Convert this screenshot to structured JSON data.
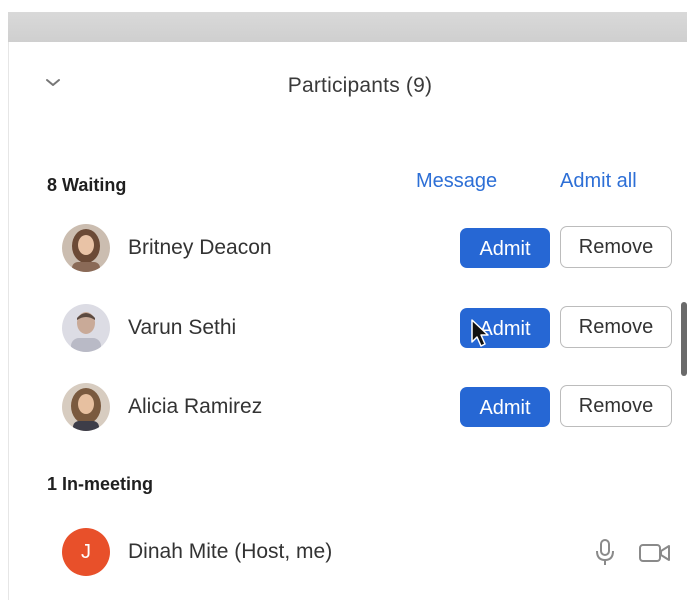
{
  "header": {
    "title": "Participants (9)",
    "collapse_icon": "chevron-down-icon"
  },
  "waiting": {
    "label": "8 Waiting",
    "message_label": "Message",
    "admit_all_label": "Admit all",
    "people": [
      {
        "name": "Britney Deacon",
        "admit_label": "Admit",
        "remove_label": "Remove"
      },
      {
        "name": "Varun Sethi",
        "admit_label": "Admit",
        "remove_label": "Remove"
      },
      {
        "name": "Alicia Ramirez",
        "admit_label": "Admit",
        "remove_label": "Remove"
      }
    ]
  },
  "in_meeting": {
    "label": "1 In-meeting",
    "people": [
      {
        "name": "Dinah Mite (Host, me)",
        "initial": "J",
        "mic_icon": "microphone-icon",
        "video_icon": "video-camera-icon"
      }
    ]
  },
  "colors": {
    "accent": "#2667d4",
    "link": "#2d6fd6",
    "host_avatar": "#e8502a"
  }
}
